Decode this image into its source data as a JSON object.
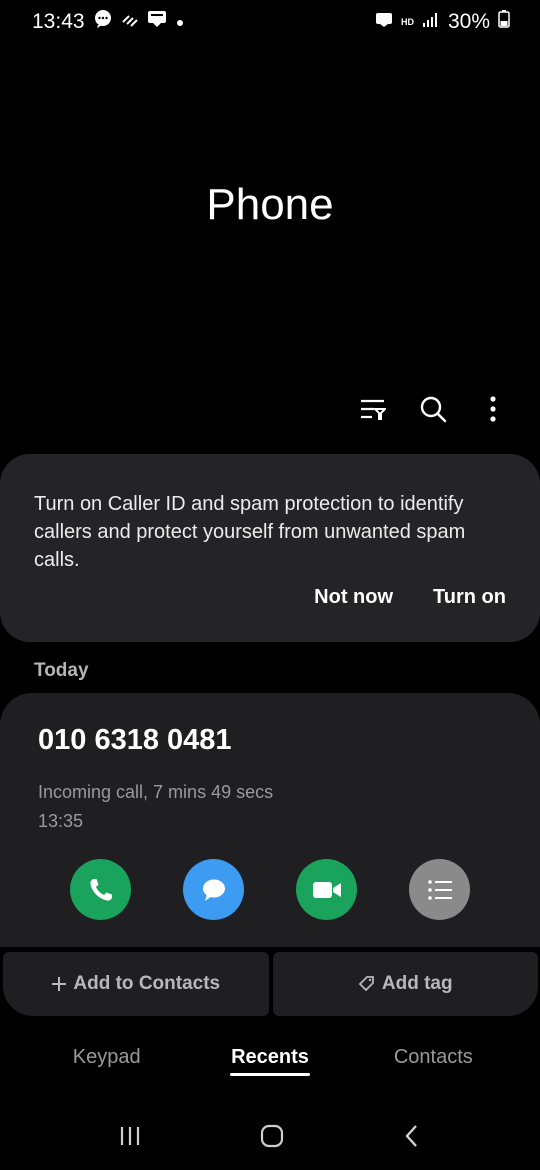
{
  "status": {
    "time": "13:43",
    "hd": "HD",
    "battery_pct": "30%"
  },
  "header": {
    "title": "Phone"
  },
  "banner": {
    "text": "Turn on Caller ID and spam protection to identify callers and protect yourself from unwanted spam calls.",
    "not_now": "Not now",
    "turn_on": "Turn on"
  },
  "recents": {
    "section_label": "Today",
    "call": {
      "number": "010 6318 0481",
      "detail": "Incoming call, 7 mins 49 secs",
      "time": "13:35"
    },
    "add_to_contacts": "Add to Contacts",
    "add_tag": "Add tag"
  },
  "tabs": [
    {
      "label": "Keypad"
    },
    {
      "label": "Recents"
    },
    {
      "label": "Contacts"
    }
  ],
  "colors": {
    "call_green": "#1aa35c",
    "message_blue": "#3d9bf2",
    "video_green": "#1aa35c",
    "details_gray": "#8a8a8a"
  }
}
